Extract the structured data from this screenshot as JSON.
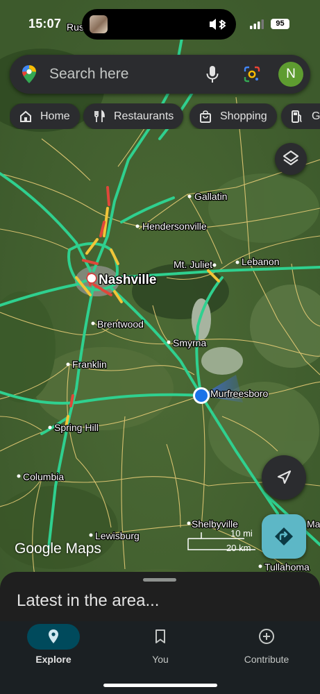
{
  "status_bar": {
    "time": "15:07",
    "battery": "95"
  },
  "search": {
    "placeholder": "Search here",
    "account_initial": "N"
  },
  "chips": [
    {
      "label": "Home",
      "icon": "home-icon"
    },
    {
      "label": "Restaurants",
      "icon": "fork-knife-icon"
    },
    {
      "label": "Shopping",
      "icon": "shopping-bag-icon"
    },
    {
      "label": "Ga",
      "icon": "gas-pump-icon"
    }
  ],
  "map": {
    "places": [
      {
        "name": "Rus"
      },
      {
        "name": "Gallatin"
      },
      {
        "name": "Hendersonville"
      },
      {
        "name": "Mt. Juliet"
      },
      {
        "name": "Lebanon"
      },
      {
        "name": "Nashville"
      },
      {
        "name": "Brentwood"
      },
      {
        "name": "Smyrna"
      },
      {
        "name": "Franklin"
      },
      {
        "name": "Murfreesboro"
      },
      {
        "name": "Spring Hill"
      },
      {
        "name": "Columbia"
      },
      {
        "name": "Shelbyville"
      },
      {
        "name": "Lewisburg"
      },
      {
        "name": "Tullahoma"
      },
      {
        "name": "Man"
      }
    ],
    "attribution": "Google Maps",
    "scale": {
      "miles": "10 mi",
      "km": "20 km"
    },
    "colors": {
      "traffic_clear": "#2fd08f",
      "traffic_slow": "#f2c438",
      "traffic_heavy": "#e0473a",
      "roads": "#f0d27a",
      "my_location": "#1a73e8"
    }
  },
  "sheet": {
    "title": "Latest in the area..."
  },
  "nav": [
    {
      "label": "Explore",
      "icon": "explore-pin-icon",
      "active": true
    },
    {
      "label": "You",
      "icon": "bookmark-icon",
      "active": false
    },
    {
      "label": "Contribute",
      "icon": "add-circle-icon",
      "active": false
    }
  ]
}
